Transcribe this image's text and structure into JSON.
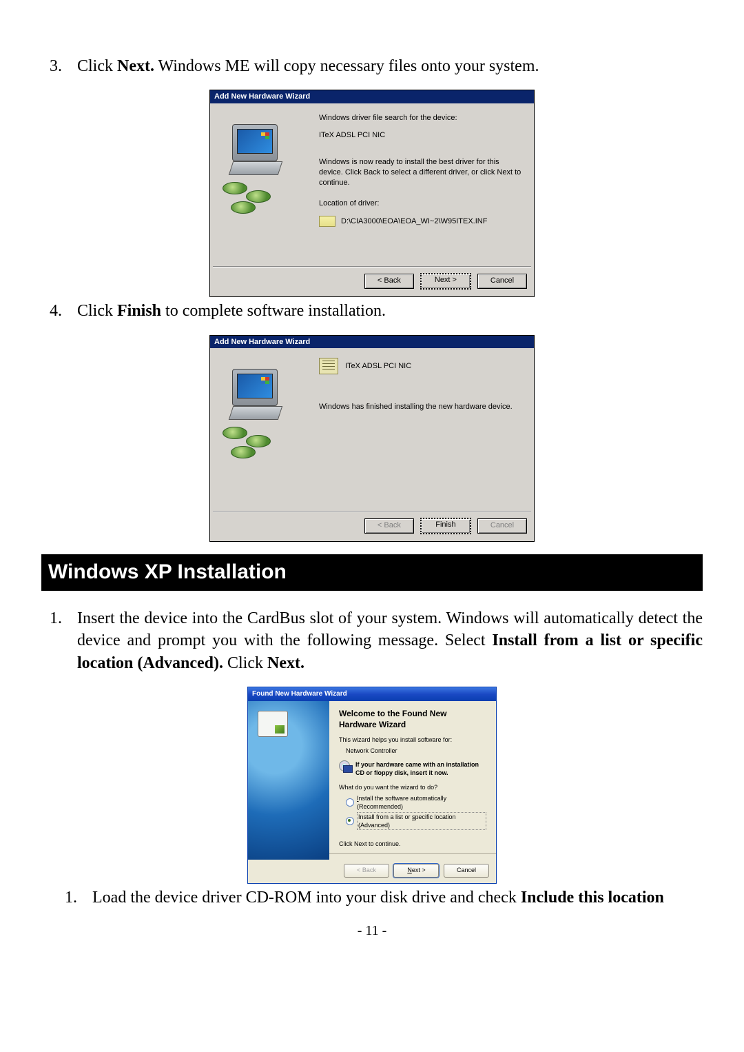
{
  "steps_me": [
    {
      "num": "3.",
      "pre": "Click ",
      "bold": "Next.",
      "post": "  Windows ME will copy necessary files onto your system."
    },
    {
      "num": "4.",
      "pre": "Click ",
      "bold": "Finish",
      "post": " to complete software installation."
    }
  ],
  "section_title": "Windows XP Installation",
  "steps_xp": [
    {
      "num": "1.",
      "parts": [
        {
          "t": "Insert the device into the CardBus slot of your system. Windows will automatically detect the device and prompt you with the following message. Select "
        },
        {
          "t": "Install from a list or specific location (Advanced).",
          "b": true
        },
        {
          "t": "  Click "
        },
        {
          "t": "Next.",
          "b": true
        }
      ]
    },
    {
      "num": "1.",
      "parts": [
        {
          "t": "Load the device driver CD-ROM into your disk drive and check "
        },
        {
          "t": "Include this location",
          "b": true
        }
      ]
    }
  ],
  "dlg1": {
    "title": "Add New Hardware Wizard",
    "line1": "Windows driver file search for the device:",
    "device": "ITeX ADSL PCI NIC",
    "msg": "Windows is now ready to install the best driver for this device. Click Back to select a different driver, or click Next to continue.",
    "loc_label": "Location of driver:",
    "loc_path": "D:\\CIA3000\\EOA\\EOA_WI~2\\W95ITEX.INF",
    "back": "< Back",
    "next": "Next >",
    "cancel": "Cancel"
  },
  "dlg2": {
    "title": "Add New Hardware Wizard",
    "device": "ITeX ADSL PCI NIC",
    "msg": "Windows has finished installing the new hardware device.",
    "back": "< Back",
    "finish": "Finish",
    "cancel": "Cancel"
  },
  "dlg3": {
    "title": "Found New Hardware Wizard",
    "h1a": "Welcome to the Found New",
    "h1b": "Hardware Wizard",
    "helps": "This wizard helps you install software for:",
    "device": "Network Controller",
    "cd_bold": "If your hardware came with an installation CD or floppy disk, insert it now.",
    "what": "What do you want the wizard to do?",
    "opt1": "Install the software automatically (Recommended)",
    "opt2": "Install from a list or specific location (Advanced)",
    "click_next": "Click Next to continue.",
    "back": "< Back",
    "next": "Next >",
    "cancel": "Cancel"
  },
  "page_number": "- 11 -"
}
